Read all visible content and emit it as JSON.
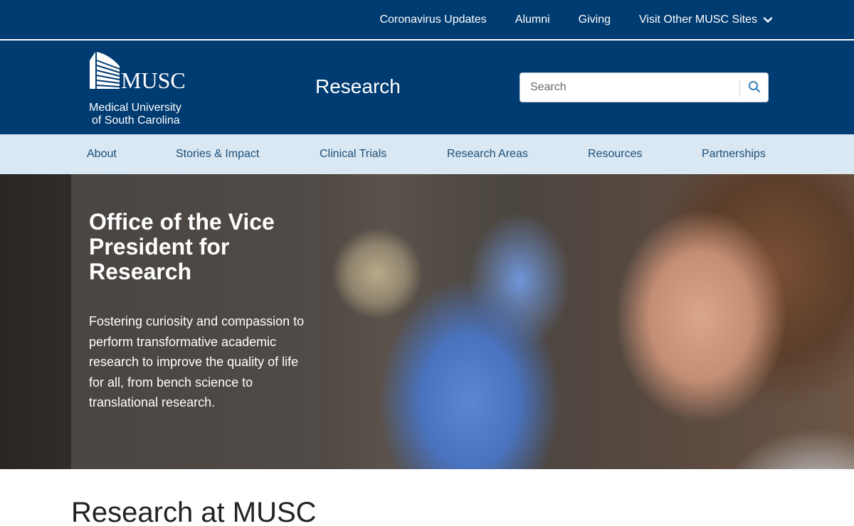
{
  "utility_nav": {
    "links": [
      {
        "label": "Coronavirus Updates"
      },
      {
        "label": "Alumni"
      },
      {
        "label": "Giving"
      },
      {
        "label": "Visit Other MUSC Sites",
        "icon": "chevron-down-icon"
      }
    ]
  },
  "header": {
    "logo": {
      "wordmark": "MUSC",
      "line1": "Medical University",
      "line2": "of South Carolina"
    },
    "site_title": "Research",
    "search": {
      "placeholder": "Search",
      "value": "",
      "icon": "search-icon"
    }
  },
  "main_nav": {
    "items": [
      {
        "label": "About"
      },
      {
        "label": "Stories & Impact"
      },
      {
        "label": "Clinical Trials"
      },
      {
        "label": "Research Areas"
      },
      {
        "label": "Resources"
      },
      {
        "label": "Partnerships"
      }
    ]
  },
  "hero": {
    "title": "Office of the Vice President for Research",
    "text": "Fostering curiosity and compassion to perform transformative academic research to improve the quality of life for all, from bench science to translational research."
  },
  "main": {
    "heading": "Research at MUSC"
  },
  "colors": {
    "brand_navy": "#003b71",
    "nav_bg": "#d9e8f3",
    "nav_text": "#1d4e78",
    "search_icon": "#3a7fb6"
  }
}
